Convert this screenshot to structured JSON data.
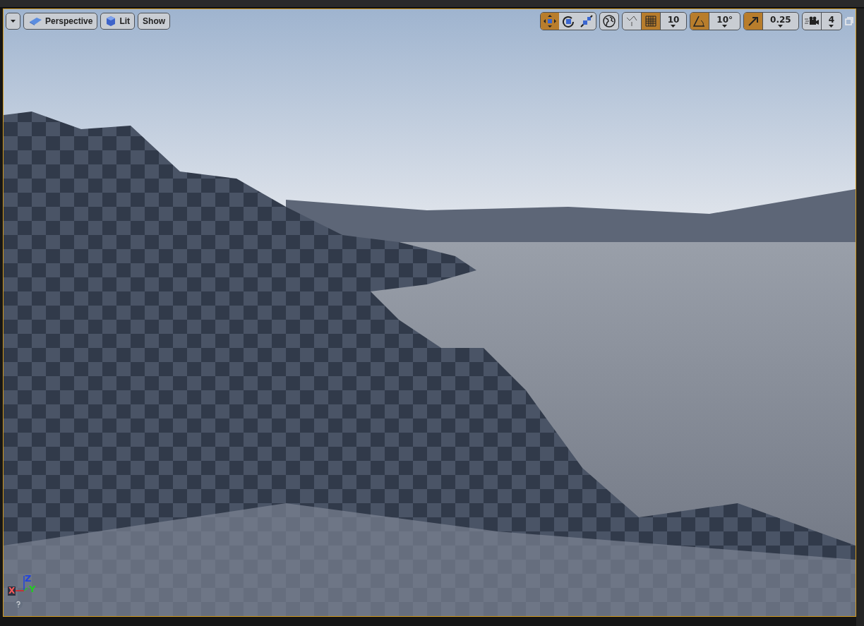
{
  "viewport": {
    "left_toolbar": [
      {
        "kind": "menu"
      },
      {
        "kind": "perspective",
        "label": "Perspective"
      },
      {
        "kind": "lit",
        "label": "Lit"
      },
      {
        "kind": "plain",
        "label": "Show"
      }
    ],
    "transform_tools": [
      {
        "kind": "translate",
        "selected": true
      },
      {
        "kind": "rotate",
        "selected": false
      },
      {
        "kind": "scale",
        "selected": false
      }
    ],
    "snap_groups": [
      {
        "kind": "grid",
        "on": true,
        "value": "10"
      },
      {
        "kind": "angle",
        "on": true,
        "value": "10°"
      },
      {
        "kind": "scale",
        "on": true,
        "value": "0.25"
      },
      {
        "kind": "camera",
        "on": false,
        "value": "4"
      }
    ],
    "axis_labels": {
      "x": "X",
      "y": "Y",
      "z": "Z"
    }
  }
}
